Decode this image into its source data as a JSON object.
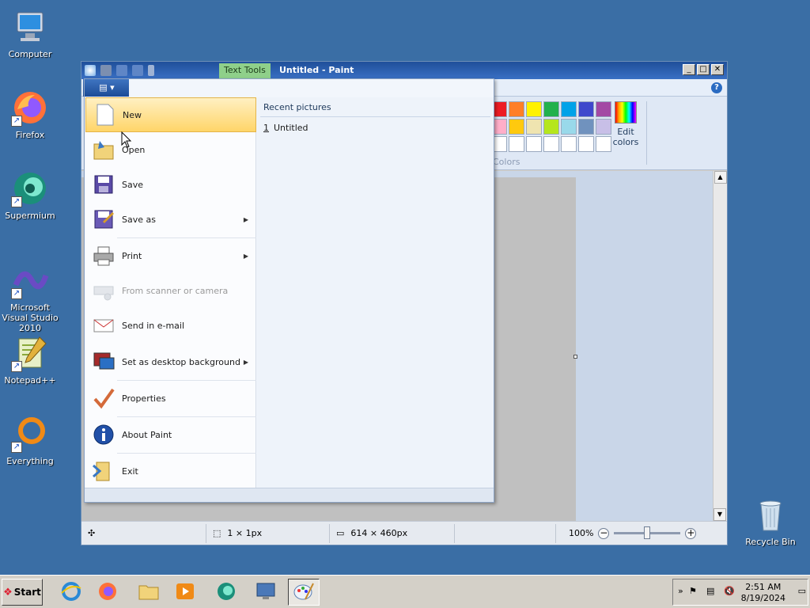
{
  "desktop": {
    "icons": [
      {
        "label": "Computer",
        "icon": "computer-icon"
      },
      {
        "label": "Firefox",
        "icon": "firefox-icon"
      },
      {
        "label": "Supermium",
        "icon": "supermium-icon"
      },
      {
        "label": "Microsoft Visual Studio 2010",
        "icon": "visual-studio-icon"
      },
      {
        "label": "Notepad++",
        "icon": "notepadpp-icon"
      },
      {
        "label": "Everything",
        "icon": "everything-icon"
      },
      {
        "label": "Recycle Bin",
        "icon": "recycle-bin-icon"
      }
    ]
  },
  "window": {
    "title": "Untitled - Paint",
    "context_tab": "Text Tools",
    "app_menu_glyph": "▤ ▾",
    "caption_buttons": {
      "minimize": "_",
      "maximize": "□",
      "close": "✕"
    },
    "help_glyph": "?",
    "scroll_up_glyph": "▲",
    "scroll_down_glyph": "▼"
  },
  "ribbon": {
    "colors_group_label": "Colors",
    "edit_colors_label": "Edit colors",
    "palette_row1": [
      "#ed1c24",
      "#ff7f27",
      "#fff200",
      "#22b14c",
      "#00a2e8",
      "#3f48cc",
      "#a349a4"
    ],
    "palette_row2": [
      "#ffaec9",
      "#ffc90e",
      "#efe4b0",
      "#b5e61d",
      "#99d9ea",
      "#7092be",
      "#c8bfe7"
    ],
    "palette_row3": [
      "#ffffff",
      "#ffffff",
      "#ffffff",
      "#ffffff",
      "#ffffff",
      "#ffffff",
      "#ffffff"
    ]
  },
  "status": {
    "cursor_pos": "",
    "selection_size": "1 × 1px",
    "image_size": "614 × 460px",
    "zoom": "100%",
    "zoom_level_fraction": 0.5,
    "zoom_out": "−",
    "zoom_in": "+"
  },
  "app_menu": {
    "items": [
      {
        "label": "New",
        "icon": "new-file-icon",
        "submenu": false,
        "disabled": false,
        "highlighted": true
      },
      {
        "label": "Open",
        "icon": "open-folder-icon",
        "submenu": false,
        "disabled": false
      },
      {
        "label": "Save",
        "icon": "save-disk-icon",
        "submenu": false,
        "disabled": false
      },
      {
        "label": "Save as",
        "icon": "save-as-icon",
        "submenu": true,
        "disabled": false
      },
      {
        "label": "Print",
        "icon": "printer-icon",
        "submenu": true,
        "disabled": false
      },
      {
        "label": "From scanner or camera",
        "icon": "scanner-icon",
        "submenu": false,
        "disabled": true
      },
      {
        "label": "Send in e-mail",
        "icon": "email-icon",
        "submenu": false,
        "disabled": false
      },
      {
        "label": "Set as desktop background",
        "icon": "desktop-background-icon",
        "submenu": true,
        "disabled": false
      },
      {
        "label": "Properties",
        "icon": "checkmark-icon",
        "submenu": false,
        "disabled": false
      },
      {
        "label": "About Paint",
        "icon": "info-icon",
        "submenu": false,
        "disabled": false
      },
      {
        "label": "Exit",
        "icon": "exit-icon",
        "submenu": false,
        "disabled": false
      }
    ],
    "submenu_glyph": "▶",
    "recent_title": "Recent pictures",
    "recent_items": [
      {
        "number": "1",
        "label": "Untitled"
      }
    ]
  },
  "taskbar": {
    "start_label": "Start",
    "start_glyph": "❖",
    "pinned": [
      {
        "name": "internet-explorer-icon"
      },
      {
        "name": "firefox-icon"
      },
      {
        "name": "file-explorer-icon"
      },
      {
        "name": "media-player-icon"
      },
      {
        "name": "supermium-icon"
      },
      {
        "name": "remote-desktop-icon"
      },
      {
        "name": "paint-icon",
        "active": true
      }
    ],
    "tray_expand_glyph": "»",
    "time": "2:51 AM",
    "date": "8/19/2024"
  }
}
